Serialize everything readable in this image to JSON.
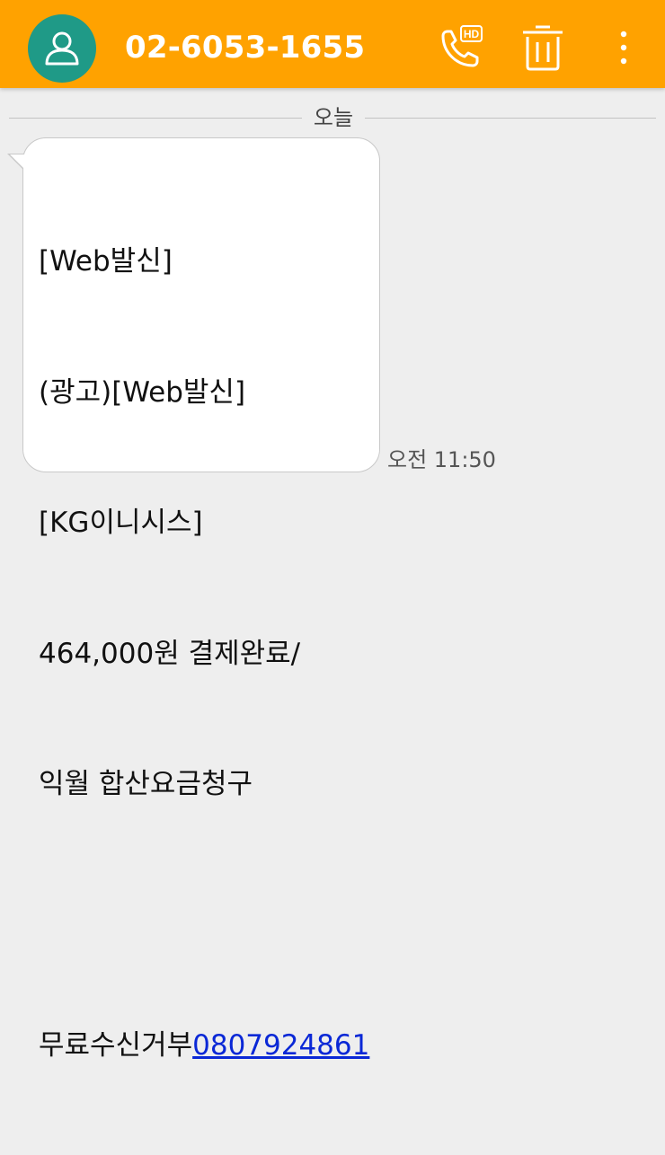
{
  "header": {
    "contact_number": "02-6053-1655",
    "avatar_icon": "person-icon",
    "call_icon": "hd-call-icon",
    "delete_icon": "trash-icon",
    "more_icon": "more-vertical-icon",
    "hd_badge": "HD"
  },
  "conversation": {
    "date_label": "오늘",
    "messages": [
      {
        "lines": [
          "[Web발신]",
          "(광고)[Web발신]",
          "[KG이니시스]",
          "464,000원 결제완료/",
          "익월 합산요금청구",
          "",
          "무료수신거부"
        ],
        "link": "0807924861",
        "time": "오전 11:50"
      }
    ]
  },
  "colors": {
    "topbar": "#ffa200",
    "avatar": "#1f9a87",
    "background": "#eeeeee",
    "link": "#0a28d6"
  }
}
